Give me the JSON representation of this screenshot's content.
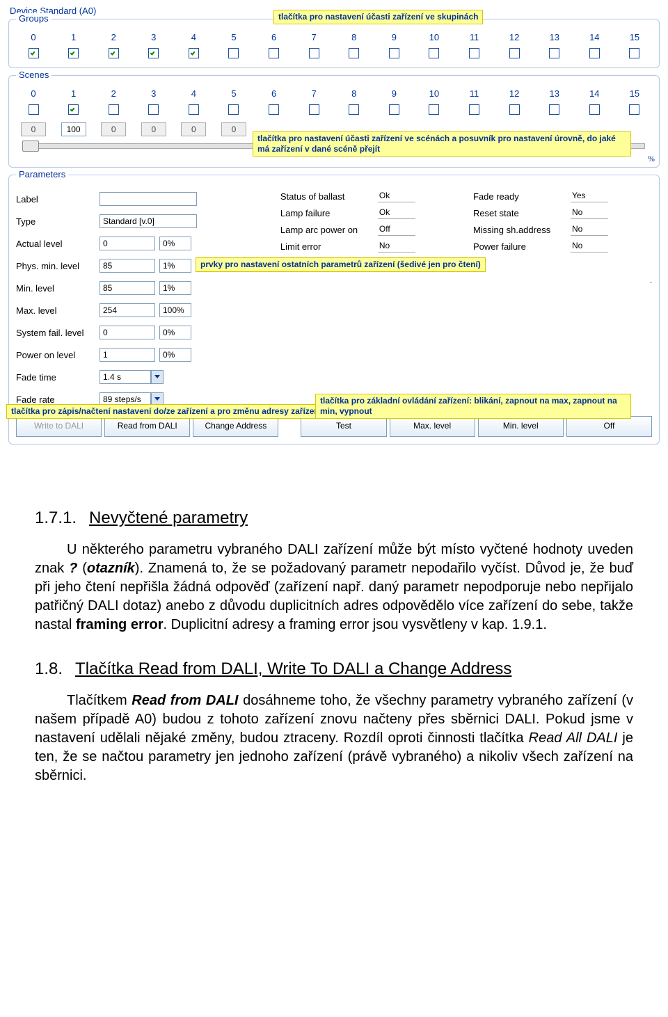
{
  "deviceTitle": "Device Standard (A0)",
  "groupsLegend": "Groups",
  "scenesLegend": "Scenes",
  "paramsLegend": "Parameters",
  "callouts": {
    "groups": "tlačítka pro nastavení účasti zařízení ve skupinách",
    "scenes": "tlačítka pro nastavení účasti zařízení ve scénách a posuvník pro nastavení úrovně, do jaké má zařízení v dané scéně přejít",
    "params": "prvky pro nastavení ostatních parametrů zařízení (šedivé jen pro čtení)",
    "left": "tlačítka pro zápis/načtení nastavení do/ze zařízení a pro změnu adresy zařízení",
    "right": "tlačítka pro základní ovládání zařízení: blikání, zapnout na max, zapnout na min, vypnout"
  },
  "numbers": [
    "0",
    "1",
    "2",
    "3",
    "4",
    "5",
    "6",
    "7",
    "8",
    "9",
    "10",
    "11",
    "12",
    "13",
    "14",
    "15"
  ],
  "groupsChecked": [
    true,
    true,
    true,
    true,
    true,
    false,
    false,
    false,
    false,
    false,
    false,
    false,
    false,
    false,
    false,
    false
  ],
  "scenesChecked": [
    false,
    true,
    false,
    false,
    false,
    false,
    false,
    false,
    false,
    false,
    false,
    false,
    false,
    false,
    false,
    false
  ],
  "sceneValues": [
    "0",
    "100",
    "0",
    "0",
    "0",
    "0"
  ],
  "percent": "%",
  "paramLabels": {
    "label": "Label",
    "type": "Type",
    "actual": "Actual level",
    "physmin": "Phys. min. level",
    "min": "Min. level",
    "max": "Max. level",
    "sysfail": "System fail. level",
    "poweron": "Power on level",
    "fadetime": "Fade time",
    "faderate": "Fade rate"
  },
  "paramValues": {
    "label": "",
    "type": "Standard [v.0]",
    "actual": "0",
    "actual_pct": "0%",
    "physmin": "85",
    "physmin_pct": "1%",
    "min": "85",
    "min_pct": "1%",
    "max": "254",
    "max_pct": "100%",
    "sysfail": "0",
    "sysfail_pct": "0%",
    "poweron": "1",
    "poweron_pct": "0%",
    "fadetime": "1.4 s",
    "faderate": "89 steps/s"
  },
  "status": {
    "ballast_l": "Status of ballast",
    "ballast_v": "Ok",
    "lampfail_l": "Lamp failure",
    "lampfail_v": "Ok",
    "arc_l": "Lamp arc power on",
    "arc_v": "Off",
    "limit_l": "Limit error",
    "limit_v": "No",
    "faderdy_l": "Fade ready",
    "faderdy_v": "Yes",
    "reset_l": "Reset state",
    "reset_v": "No",
    "missing_l": "Missing sh.address",
    "missing_v": "No",
    "pfail_l": "Power failure",
    "pfail_v": "No"
  },
  "buttons": {
    "write": "Write to DALI",
    "read": "Read from DALI",
    "change": "Change Address",
    "test": "Test",
    "maxl": "Max. level",
    "minl": "Min. level",
    "off": "Off"
  },
  "doc": {
    "h171_num": "1.7.1.",
    "h171_title": "Nevyčtené parametry",
    "p1a": "U některého parametru vybraného DALI zařízení může být místo vyčtené hodnoty uveden znak ",
    "p1b": "?",
    "p1c": " (",
    "p1d": "otazník",
    "p1e": "). Znamená to, že se požadovaný parametr nepodařilo vyčíst. Důvod je, že buď při jeho čtení nepřišla žádná odpověď (zařízení např. daný parametr nepodporuje nebo nepřijalo patřičný DALI dotaz) anebo z důvodu duplicitních adres odpovědělo více zařízení do sebe, takže nastal ",
    "p1f": "framing error",
    "p1g": ". Duplicitní adresy a framing error jsou vysvětleny v kap. 1.9.1.",
    "h18_num": "1.8.",
    "h18_title": "Tlačítka Read from DALI, Write To DALI a Change Address",
    "p2a": "Tlačítkem ",
    "p2b": "Read from DALI",
    "p2c": " dosáhneme toho, že všechny parametry vybraného zařízení (v našem případě A0) budou z tohoto zařízení znovu načteny přes sběrnici DALI. Pokud jsme v nastavení udělali nějaké změny, budou ztraceny. Rozdíl oproti činnosti tlačítka ",
    "p2d": "Read All DALI",
    "p2e": " je ten, že se načtou parametry jen jednoho zařízení (právě vybraného) a nikoliv všech zařízení na sběrnici."
  }
}
